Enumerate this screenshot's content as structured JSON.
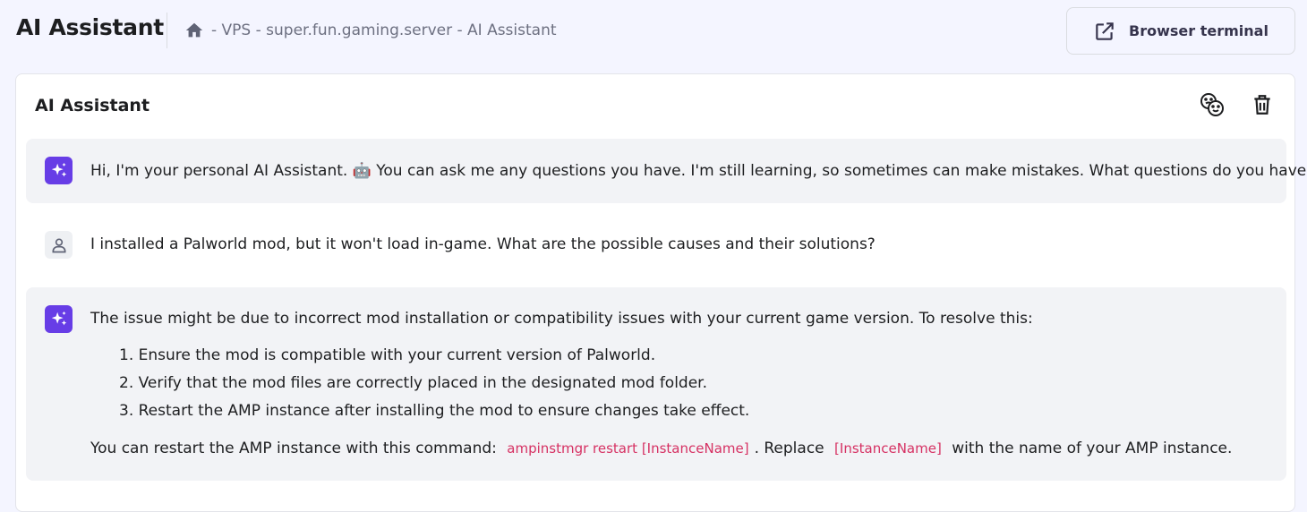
{
  "header": {
    "title": "AI Assistant",
    "breadcrumb": "- VPS - super.fun.gaming.server - AI Assistant",
    "terminal_button": "Browser terminal"
  },
  "card": {
    "title": "AI Assistant"
  },
  "messages": {
    "greeting": "Hi, I'm your personal AI Assistant. 🤖 You can ask me any questions you have. I'm still learning, so sometimes can make mistakes. What questions do you have?",
    "user_question": "I installed a Palworld mod, but it won't load in-game. What are the possible causes and their solutions?",
    "answer_intro": "The issue might be due to incorrect mod installation or compatibility issues with your current game version. To resolve this:",
    "answer_steps": [
      "1. Ensure the mod is compatible with your current version of Palworld.",
      "2. Verify that the mod files are correctly placed in the designated mod folder.",
      "3. Restart the AMP instance after installing the mod to ensure changes take effect."
    ],
    "answer_outro_1": "You can restart the AMP instance with this command:",
    "answer_code_1": "ampinstmgr restart [InstanceName]",
    "answer_outro_2": ". Replace",
    "answer_code_2": "[InstanceName]",
    "answer_outro_3": "with the name of your AMP instance."
  },
  "colors": {
    "accent": "#673de6",
    "code": "#d63163",
    "ai_bubble": "#f2f3f6",
    "page_bg": "#f4f5ff"
  },
  "icons": {
    "home": "home-icon",
    "external": "external-link-icon",
    "feedback": "emoji-feedback-icon",
    "delete": "trash-icon",
    "ai": "sparkles-icon",
    "user": "user-icon"
  }
}
